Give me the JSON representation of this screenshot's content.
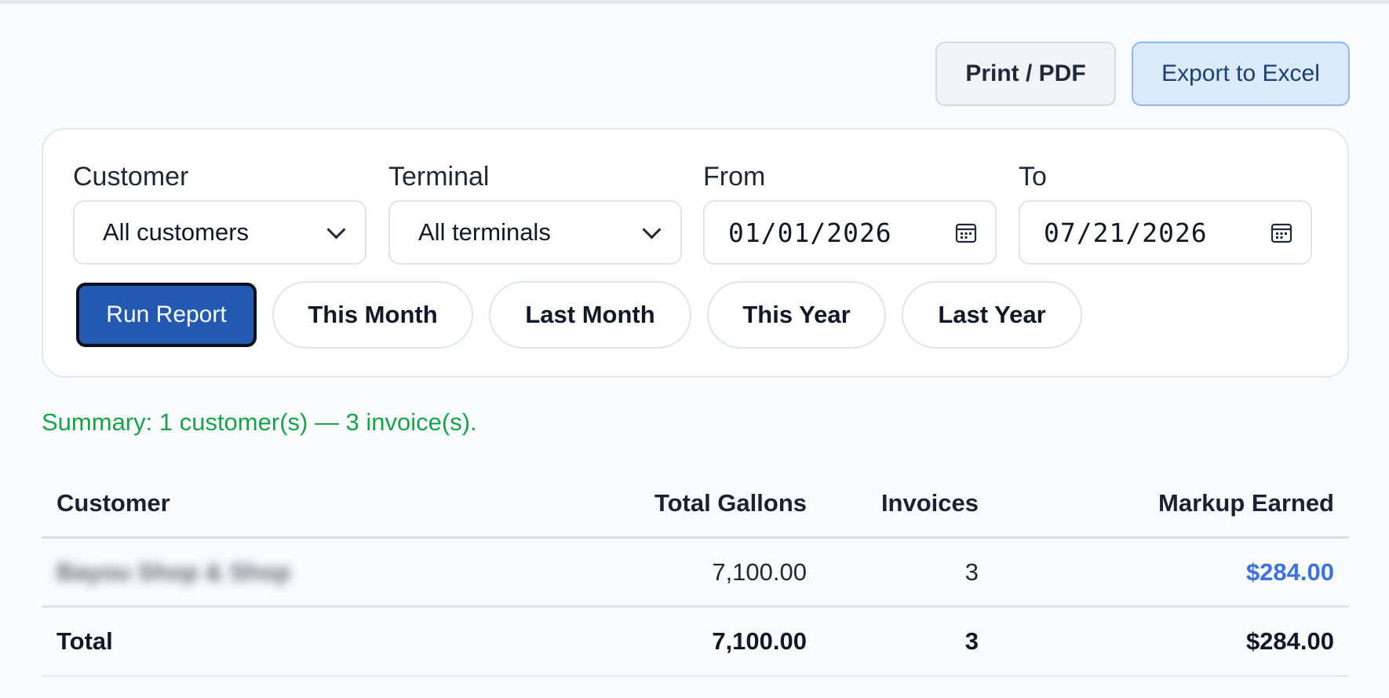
{
  "toolbar": {
    "print_label": "Print / PDF",
    "export_label": "Export to Excel"
  },
  "filters": {
    "customer": {
      "label": "Customer",
      "value": "All customers"
    },
    "terminal": {
      "label": "Terminal",
      "value": "All terminals"
    },
    "from": {
      "label": "From",
      "value": "01/01/2026"
    },
    "to": {
      "label": "To",
      "value": "07/21/2026"
    }
  },
  "buttons": {
    "run": "Run Report",
    "this_month": "This Month",
    "last_month": "Last Month",
    "this_year": "This Year",
    "last_year": "Last Year"
  },
  "summary": "Summary: 1 customer(s) — 3 invoice(s).",
  "table": {
    "headers": {
      "customer": "Customer",
      "gallons": "Total Gallons",
      "invoices": "Invoices",
      "markup": "Markup Earned"
    },
    "rows": [
      {
        "customer": "Bayou Shop & Shop",
        "gallons": "7,100.00",
        "invoices": "3",
        "markup": "$284.00"
      }
    ],
    "total": {
      "label": "Total",
      "gallons": "7,100.00",
      "invoices": "3",
      "markup": "$284.00"
    }
  },
  "colors": {
    "accent": "#2359b0",
    "summary_green": "#16a34a",
    "markup_blue": "#3b72e0"
  }
}
